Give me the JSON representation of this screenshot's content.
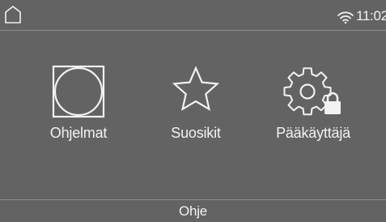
{
  "status": {
    "time": "11:02",
    "home_icon": "home-icon",
    "wifi_icon": "wifi-icon"
  },
  "menu": {
    "items": [
      {
        "label": "Ohjelmat",
        "icon": "program-drum-icon"
      },
      {
        "label": "Suosikit",
        "icon": "star-icon"
      },
      {
        "label": "Pääkäyttäjä",
        "icon": "gear-lock-icon"
      }
    ]
  },
  "footer": {
    "help_label": "Ohje"
  },
  "colors": {
    "background": "#636363",
    "foreground": "#f2f2f2",
    "divider": "#8a8a8a"
  }
}
